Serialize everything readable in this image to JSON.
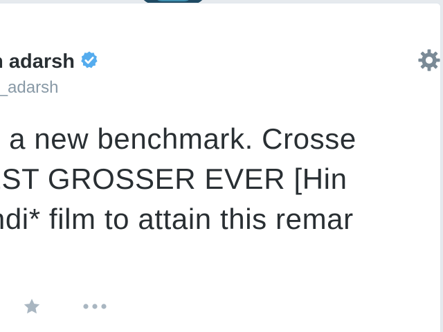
{
  "tweet": {
    "author": {
      "display_name": "an adarsh",
      "handle": "an_adarsh",
      "verified": true
    },
    "text_lines": [
      "ets a new benchmark. Crosse",
      "HEST GROSSER EVER [Hin",
      "Hindi* film to attain this remar"
    ],
    "actions": {
      "favorite_icon": "star-icon",
      "more_icon": "ellipsis-icon",
      "settings_icon": "gear-icon"
    }
  },
  "colors": {
    "text": "#292f33",
    "muted": "#8899a6",
    "verified": "#55acee",
    "icon": "#7a8a96",
    "card_background": "#ffffff",
    "page_background": "#e6eaee"
  }
}
